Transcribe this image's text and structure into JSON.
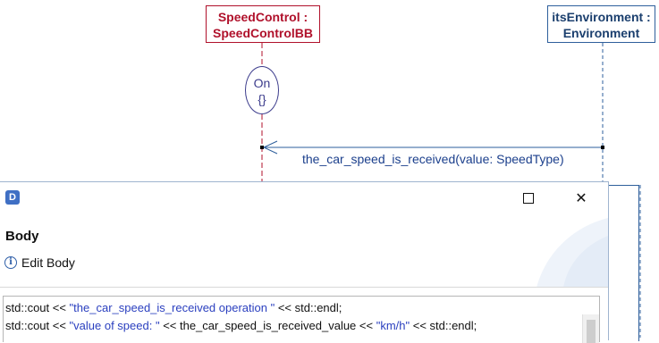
{
  "diagram": {
    "lifelines": [
      {
        "line1": "SpeedControl :",
        "line2": "SpeedControlBB",
        "color": "#b0112b"
      },
      {
        "line1": "itsEnvironment :",
        "line2": "Environment",
        "color": "#2e5f9c"
      }
    ],
    "state": {
      "name": "On",
      "body": "{}"
    },
    "message": "the_car_speed_is_received(value: SpeedType)"
  },
  "dialog": {
    "app_icon": "D",
    "title": "Body",
    "message": "Edit Body",
    "info_glyph": "i",
    "close_glyph": "✕",
    "editor": {
      "line1": {
        "a": "std::cout << ",
        "s1": "\"the_car_speed_is_received operation \"",
        "b": " << std::endl;"
      },
      "line2": {
        "a": "std::cout << ",
        "s1": "\"value of speed: \"",
        "b": " << the_car_speed_is_received_value << ",
        "s2": "\"km/h\"",
        "c": " << std::endl;"
      }
    }
  },
  "colors": {
    "lifeline_red": "#b0112b",
    "lifeline_blue": "#2e5f9c",
    "string_literal": "#2a3fbf"
  }
}
